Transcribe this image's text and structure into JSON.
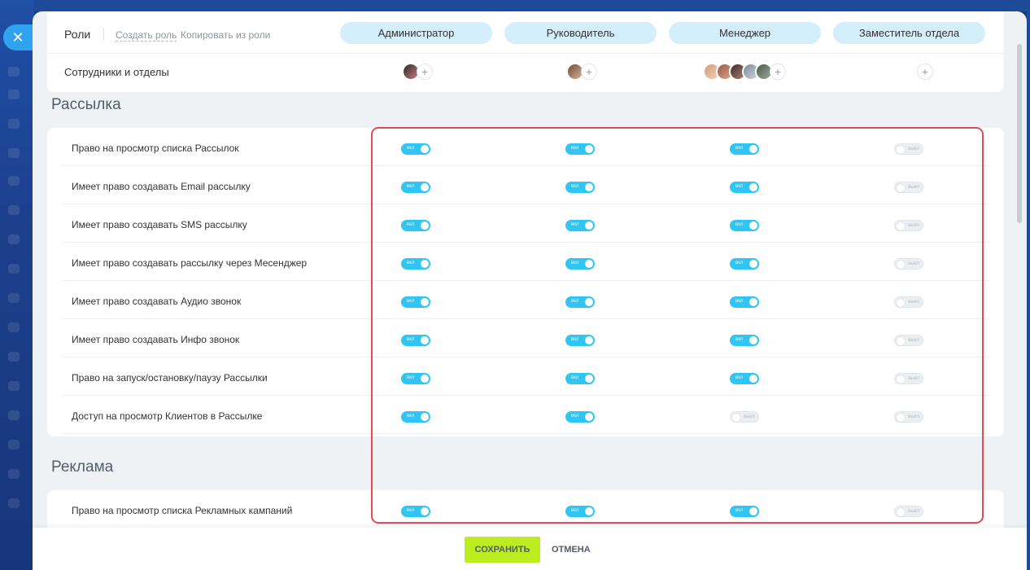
{
  "window": {
    "close_glyph": "✕"
  },
  "roles_panel": {
    "title": "Роли",
    "create_role": "Создать роль",
    "copy_role": "Копировать из роли",
    "roles": [
      "Администратор",
      "Руководитель",
      "Менеджер",
      "Заместитель отдела"
    ],
    "staff_label": "Сотрудники и отделы",
    "add_glyph": "+"
  },
  "toggle_labels": {
    "on": "вкл",
    "off": "выкл"
  },
  "sections": [
    {
      "title": "Рассылка",
      "permissions": [
        {
          "label": "Право на просмотр списка Рассылок",
          "states": [
            true,
            true,
            true,
            false
          ]
        },
        {
          "label": "Имеет право создавать Email рассылку",
          "states": [
            true,
            true,
            true,
            false
          ]
        },
        {
          "label": "Имеет право создавать SMS рассылку",
          "states": [
            true,
            true,
            true,
            false
          ]
        },
        {
          "label": "Имеет право создавать рассылку через Месенджер",
          "states": [
            true,
            true,
            true,
            false
          ]
        },
        {
          "label": "Имеет право создавать Аудио звонок",
          "states": [
            true,
            true,
            true,
            false
          ]
        },
        {
          "label": "Имеет право создавать Инфо звонок",
          "states": [
            true,
            true,
            true,
            false
          ]
        },
        {
          "label": "Право на запуск/остановку/паузу Рассылки",
          "states": [
            true,
            true,
            true,
            false
          ]
        },
        {
          "label": "Доступ на просмотр Клиентов в Рассылке",
          "states": [
            true,
            true,
            false,
            false
          ]
        }
      ]
    },
    {
      "title": "Реклама",
      "permissions": [
        {
          "label": "Право на просмотр списка Рекламных кампаний",
          "states": [
            true,
            true,
            true,
            false
          ]
        }
      ]
    }
  ],
  "footer": {
    "save": "СОХРАНИТЬ",
    "cancel": "ОТМЕНА"
  },
  "colors": {
    "accent": "#2fc6f6",
    "save_button": "#bbed21",
    "highlight": "#e24a56",
    "role_pill": "#d4eefb"
  }
}
